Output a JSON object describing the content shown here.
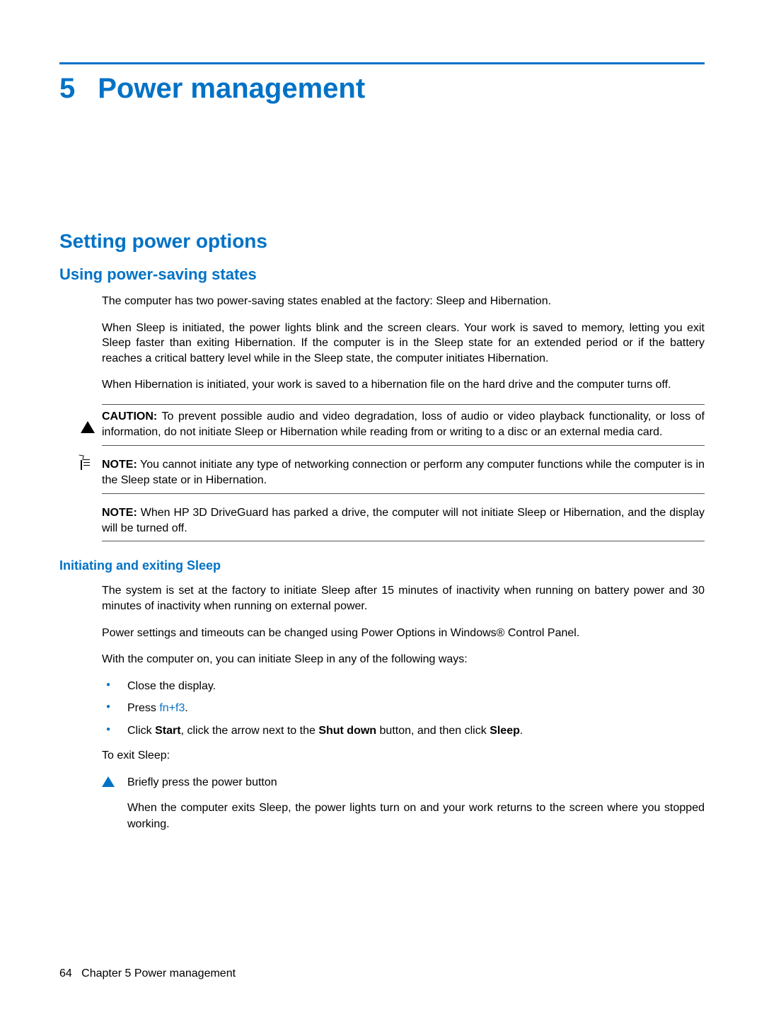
{
  "chapter": {
    "number": "5",
    "title": "Power management"
  },
  "section": {
    "title": "Setting power options"
  },
  "subsection1": {
    "title": "Using power-saving states",
    "p1": "The computer has two power-saving states enabled at the factory: Sleep and Hibernation.",
    "p2": "When Sleep is initiated, the power lights blink and the screen clears. Your work is saved to memory, letting you exit Sleep faster than exiting Hibernation. If the computer is in the Sleep state for an extended period or if the battery reaches a critical battery level while in the Sleep state, the computer initiates Hibernation.",
    "p3": "When Hibernation is initiated, your work is saved to a hibernation file on the hard drive and the computer turns off.",
    "caution": {
      "label": "CAUTION:",
      "text": "To prevent possible audio and video degradation, loss of audio or video playback functionality, or loss of information, do not initiate Sleep or Hibernation while reading from or writing to a disc or an external media card."
    },
    "note1": {
      "label": "NOTE:",
      "text": "You cannot initiate any type of networking connection or perform any computer functions while the computer is in the Sleep state or in Hibernation."
    },
    "note2": {
      "label": "NOTE:",
      "text": "When HP 3D DriveGuard has parked a drive, the computer will not initiate Sleep or Hibernation, and the display will be turned off."
    }
  },
  "subsection2": {
    "title": "Initiating and exiting Sleep",
    "p1": "The system is set at the factory to initiate Sleep after 15 minutes of inactivity when running on battery power and 30 minutes of inactivity when running on external power.",
    "p2": "Power settings and timeouts can be changed using Power Options in Windows® Control Panel.",
    "p3": "With the computer on, you can initiate Sleep in any of the following ways:",
    "bullets": {
      "b1": "Close the display.",
      "b2_pre": "Press ",
      "b2_link": "fn+f3",
      "b2_post": ".",
      "b3_pre": "Click ",
      "b3_bold1": "Start",
      "b3_mid1": ", click the arrow next to the ",
      "b3_bold2": "Shut down",
      "b3_mid2": " button, and then click ",
      "b3_bold3": "Sleep",
      "b3_post": "."
    },
    "p4": "To exit Sleep:",
    "step": "Briefly press the power button",
    "stepSub": "When the computer exits Sleep, the power lights turn on and your work returns to the screen where you stopped working."
  },
  "footer": {
    "page": "64",
    "chapterRef": "Chapter 5   Power management"
  }
}
